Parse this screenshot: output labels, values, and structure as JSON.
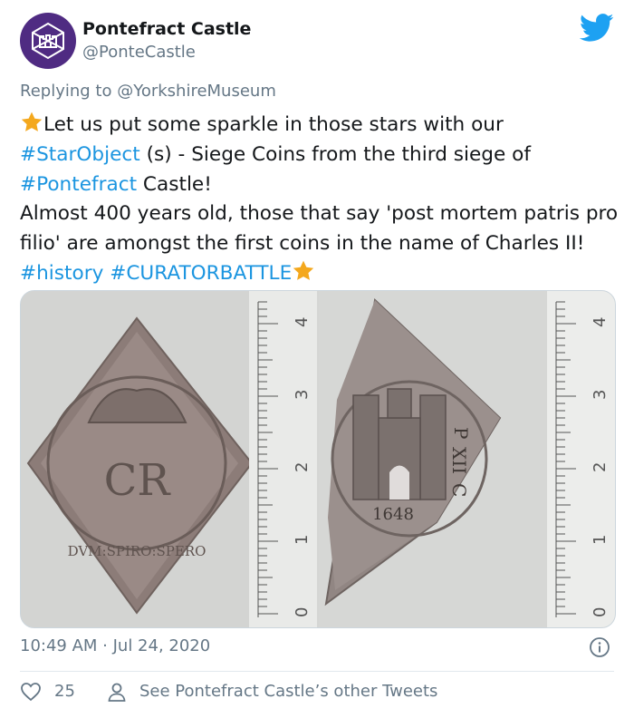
{
  "author": {
    "name": "Pontefract Castle",
    "handle": "@PonteCastle",
    "avatar_color": "#4f2b82"
  },
  "reply": {
    "prefix": "Replying to",
    "mention": "@YorkshireMuseum"
  },
  "tweet": {
    "text_1": "Let us put some sparkle in those stars with our",
    "hashtag_1": "#StarObject",
    "text_2": " (s)  - Siege Coins from the third siege of",
    "hashtag_2": "#Pontefract",
    "text_3": " Castle!",
    "text_4": "Almost 400 years old, those that say 'post mortem patris pro filio' are amongst the first coins in the name of Charles II!",
    "hashtag_3": "#history",
    "hashtag_4": "#CURATORBATTLE",
    "link_color": "#1b95e0",
    "emoji": "star-emoji"
  },
  "media": {
    "left_coin": {
      "legend": "DVM:SPIRO:SPERO",
      "monogram": "CR",
      "ruler_marks": [
        "0",
        "1",
        "2",
        "3",
        "4"
      ]
    },
    "right_coin": {
      "legend_1": "P",
      "legend_2": "XII",
      "legend_3": "C",
      "year": "1648",
      "ruler_marks": [
        "0",
        "1",
        "2",
        "3",
        "4"
      ]
    }
  },
  "meta": {
    "timestamp": "10:49 AM · Jul 24, 2020",
    "likes": "25",
    "other_tweets": "See Pontefract Castle’s other Tweets"
  },
  "colors": {
    "brand": "#1da1f2",
    "secondary_text": "#657786",
    "divider": "#e1e8ed"
  }
}
